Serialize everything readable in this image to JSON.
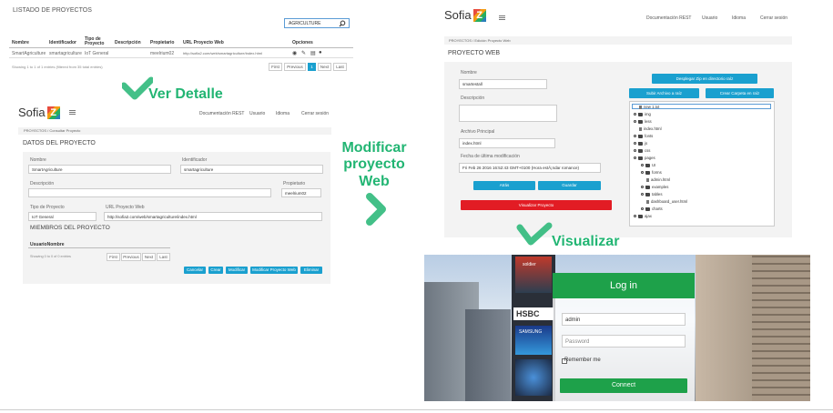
{
  "list_view": {
    "title": "LISTADO DE PROYECTOS",
    "search_value": "AGRICULTURE",
    "columns": [
      "Nombre",
      "Identificador",
      "Tipo de Proyecto",
      "Descripción",
      "Propietario",
      "URL Proyecto Web",
      "Opciones"
    ],
    "row": [
      "SmartAgriculture",
      "smartagriculture",
      "IoT General",
      "",
      "meelrium02",
      "http://sofia2.com/web/smartagriculture/index.html"
    ],
    "footer": "Showing 1 to 1 of 1 entries (filtered from 35 total entries)",
    "pager": [
      "First",
      "Previous",
      "1",
      "Next",
      "Last"
    ]
  },
  "labels": {
    "ver_detalle": "Ver Detalle",
    "modificar_line1": "Modificar",
    "modificar_line2": "proyecto",
    "modificar_line3": "Web",
    "visualizar": "Visualizar"
  },
  "detail_view": {
    "logo_text": "Sofia",
    "nav": [
      "Documentación REST",
      "Usuario",
      "Idioma",
      "Cerrar sesión"
    ],
    "breadcrumb": "PROYECTOS / Consultar Proyecto",
    "section_title": "DATOS DEL PROYECTO",
    "nombre_label": "Nombre",
    "nombre_value": "SmartAgriculture",
    "identificador_label": "Identificador",
    "identificador_value": "smartagriculture",
    "descripcion_label": "Descripción",
    "propietario_label": "Propietario",
    "propietario_value": "meelrium02",
    "tipo_label": "Tipo de Proyecto",
    "tipo_value": "IoT General",
    "url_label": "URL Proyecto Web",
    "url_value": "http://sofia2.com/web/smartagriculture/index.html",
    "miembros_title": "MIEMBROS DEL PROYECTO",
    "miembros_col": "UsuarioNombre",
    "miembros_footer": "Showing 0 to 0 of 0 entries",
    "pager": [
      "First",
      "Previous",
      "Next",
      "Last"
    ],
    "buttons": [
      "Cancelar",
      "Crear",
      "Modificar",
      "Modificar Proyecto Web",
      "Eliminar"
    ]
  },
  "edit_view": {
    "logo_text": "Sofia",
    "nav": [
      "Documentación REST",
      "Usuario",
      "Idioma",
      "Cerrar sesión"
    ],
    "breadcrumb": "PROYECTOS / Edición Proyecto Web",
    "section_title": "PROYECTO WEB",
    "nombre_label": "Nombre",
    "nombre_value": "smartestall",
    "descripcion_label": "Descripción",
    "archivo_label": "Archivo Principal",
    "archivo_value": "index.html",
    "fecha_label": "Fecha de última modificación",
    "fecha_value": "Fri Feb 26 2016 16:52:43 GMT+0100 (Hora estÃ¡ndar romance)",
    "btn_atras": "Atrás",
    "btn_guardar": "Guardar",
    "btn_visualizar": "Visualizar Proyecto",
    "btn_desplegar": "Desplegar Zip en directorio raíz",
    "btn_subir": "Subir Archivo a raíz",
    "btn_crear_carpeta": "Crear Carpeta en raíz",
    "tree": [
      "new 1.txt",
      "img",
      "less",
      "index.html",
      "fonts",
      "js",
      "css",
      "pages",
      "UI",
      "forms",
      "admin.html",
      "examples",
      "tables",
      "dashboard_user.html",
      "charts",
      "ajax"
    ]
  },
  "login_view": {
    "title": "Log in",
    "user_value": "admin",
    "password_placeholder": "Password",
    "remember": "Remember me",
    "connect": "Connect",
    "billboards": [
      "soldier",
      "HSBC",
      "SAMSUNG"
    ]
  },
  "colors": {
    "accent_green": "#22b573",
    "button_blue": "#1aa0cf",
    "danger_red": "#e21c24",
    "login_green": "#1ea14a"
  }
}
